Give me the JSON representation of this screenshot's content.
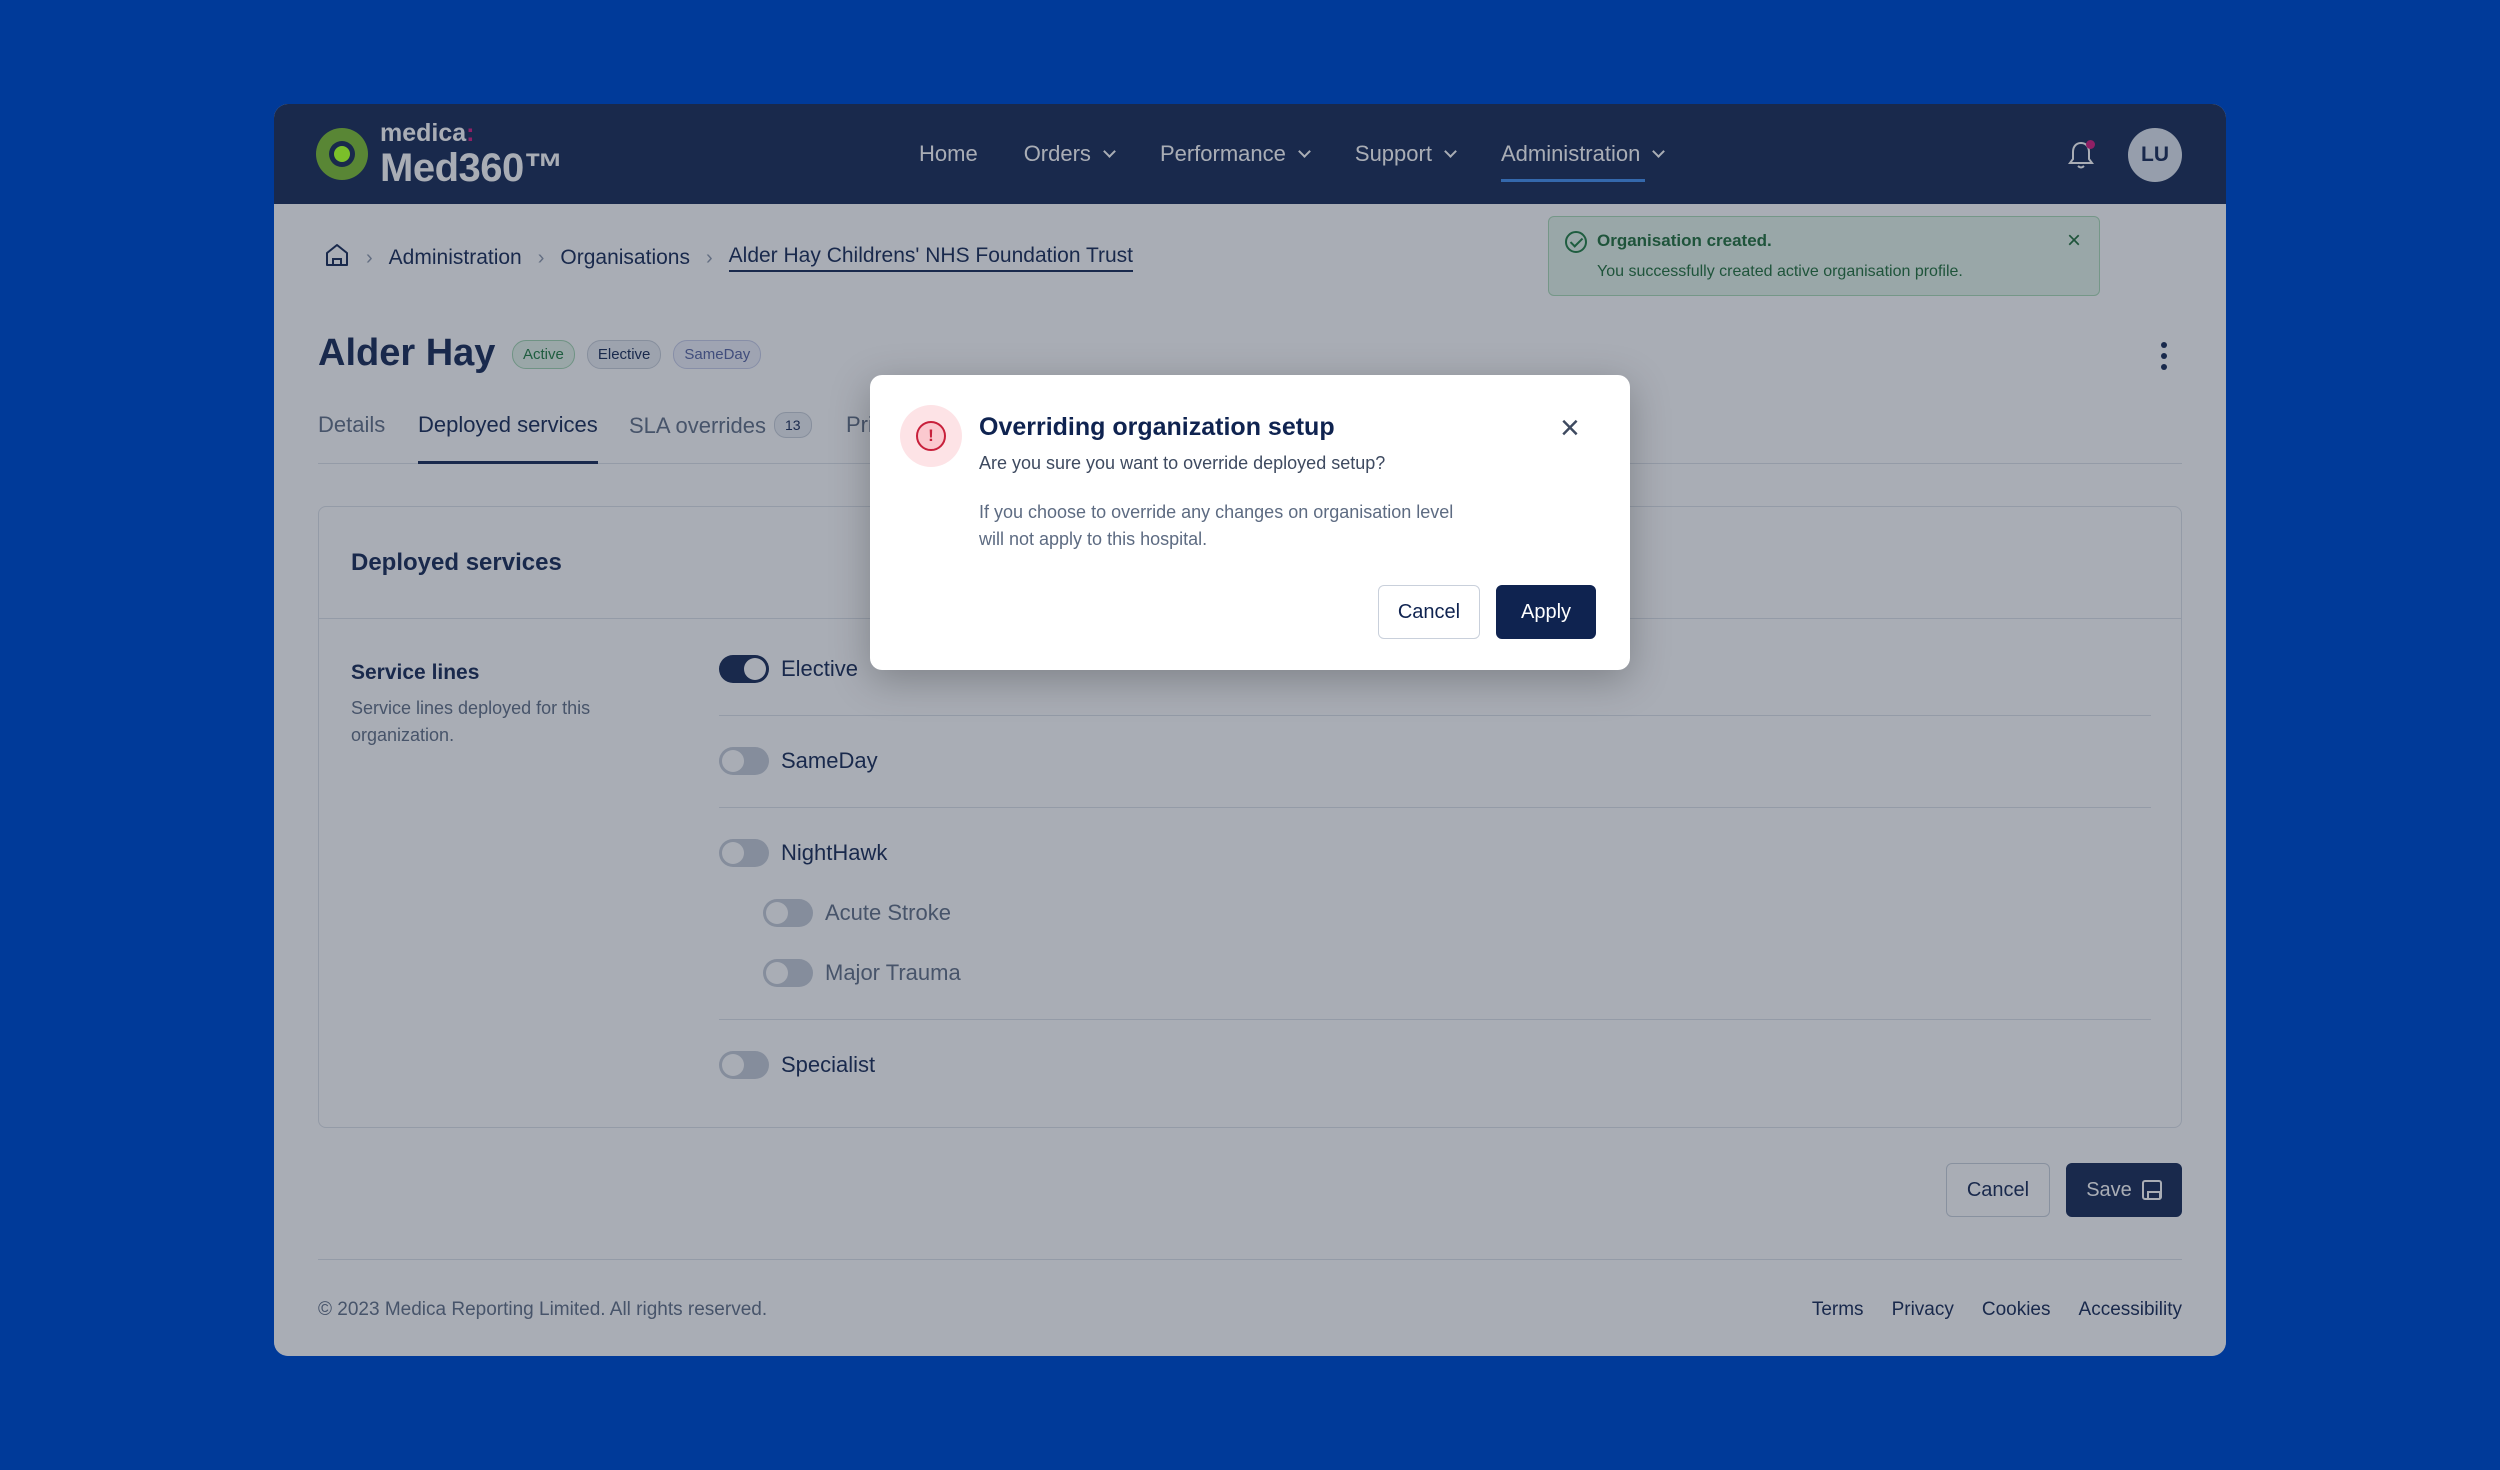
{
  "brand": {
    "small": "medica",
    "small_accent": ":",
    "big": "Med360™"
  },
  "nav": {
    "items": [
      {
        "label": "Home",
        "dropdown": false
      },
      {
        "label": "Orders",
        "dropdown": true
      },
      {
        "label": "Performance",
        "dropdown": true
      },
      {
        "label": "Support",
        "dropdown": true
      },
      {
        "label": "Administration",
        "dropdown": true,
        "active": true
      }
    ],
    "avatar_initials": "LU"
  },
  "breadcrumb": [
    "Administration",
    "Organisations",
    "Alder Hay Childrens' NHS Foundation Trust"
  ],
  "toast": {
    "title": "Organisation created.",
    "message": "You successfully created active organisation profile."
  },
  "page": {
    "title": "Alder Hay",
    "badges": [
      "Active",
      "Elective",
      "SameDay"
    ]
  },
  "tabs": [
    {
      "label": "Details"
    },
    {
      "label": "Deployed services",
      "active": true
    },
    {
      "label": "SLA overrides",
      "count": "13"
    },
    {
      "label": "Pri"
    }
  ],
  "panel": {
    "title": "Deployed services",
    "section_title": "Service lines",
    "section_desc": "Service lines deployed for this organization.",
    "services": [
      {
        "label": "Elective",
        "on": true
      },
      {
        "label": "SameDay",
        "on": false
      },
      {
        "label": "NightHawk",
        "on": false
      },
      {
        "label": "Acute Stroke",
        "on": false
      },
      {
        "label": "Major Trauma",
        "on": false
      },
      {
        "label": "Specialist",
        "on": false
      }
    ]
  },
  "actions": {
    "cancel": "Cancel",
    "save": "Save"
  },
  "footer": {
    "copyright": "© 2023 Medica Reporting Limited. All rights reserved.",
    "links": [
      "Terms",
      "Privacy",
      "Cookies",
      "Accessibility"
    ]
  },
  "modal": {
    "title": "Overriding organization setup",
    "subtitle": "Are you sure you want to override deployed setup?",
    "body": "If you choose to override any changes on organisation level will not apply to this hospital.",
    "cancel": "Cancel",
    "apply": "Apply"
  },
  "colors": {
    "navy": "#0f2350",
    "background": "#003a99",
    "accent_green": "#7bbf2a",
    "alert_red": "#c8203b"
  }
}
